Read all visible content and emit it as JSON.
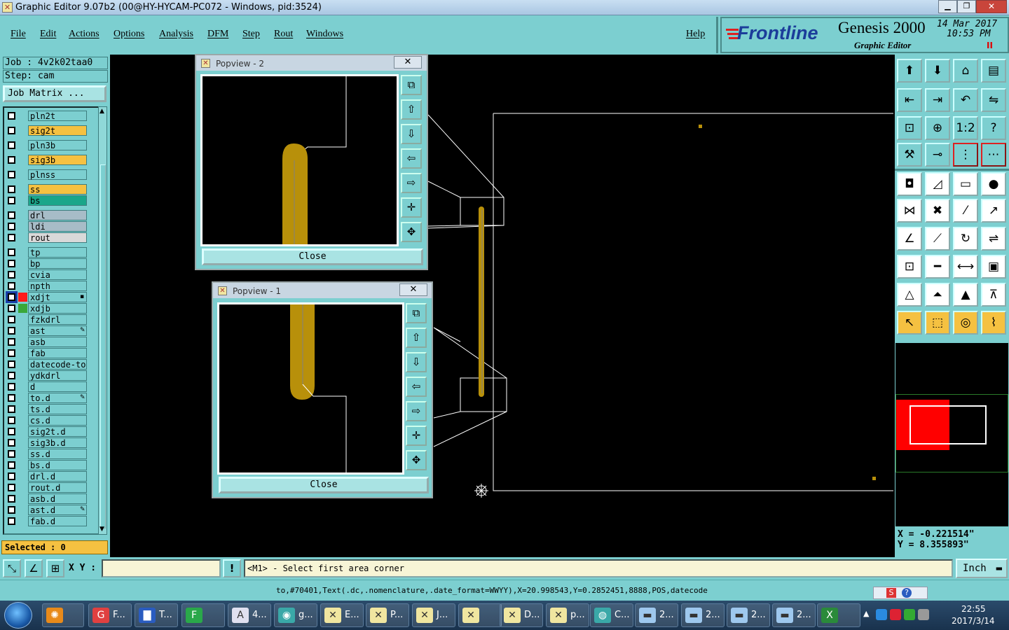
{
  "window": {
    "title": "Graphic Editor 9.07b2 (00@HY-HYCAM-PC072 - Windows, pid:3524)"
  },
  "menu": {
    "items": [
      "File",
      "Edit",
      "Actions",
      "Options",
      "Analysis",
      "DFM",
      "Step",
      "Rout",
      "Windows"
    ],
    "help": "Help"
  },
  "brand": {
    "logo": "Frontline",
    "product": "Genesis 2000",
    "subtitle": "Graphic Editor",
    "date": "14 Mar 2017",
    "time": "10:53 PM",
    "indicator": "II"
  },
  "job": {
    "job_label": "Job : 4v2k02taa0",
    "step_label": "Step: cam",
    "matrix_button": "Job Matrix ..."
  },
  "layers": [
    {
      "name": "pln2t",
      "color": "#7ccfd0"
    },
    {
      "name": "sig2t",
      "color": "#f5c141"
    },
    {
      "name": "pln3b",
      "color": "#7ccfd0"
    },
    {
      "name": "sig3b",
      "color": "#f5c141"
    },
    {
      "name": "plnss",
      "color": "#7ccfd0"
    },
    {
      "name": "ss",
      "color": "#f5c141"
    },
    {
      "name": "bs",
      "color": "#1aa68a"
    },
    {
      "name": "drl",
      "color": "#a7bcc7"
    },
    {
      "name": "ldi",
      "color": "#a7bcc7"
    },
    {
      "name": "rout",
      "color": "#d9d9d9"
    },
    {
      "name": "tp",
      "color": "#7ccfd0"
    },
    {
      "name": "bp",
      "color": "#7ccfd0"
    },
    {
      "name": "cvia",
      "color": "#7ccfd0"
    },
    {
      "name": "npth",
      "color": "#7ccfd0"
    },
    {
      "name": "xdjt",
      "color": "#7ccfd0"
    },
    {
      "name": "xdjb",
      "color": "#7ccfd0"
    },
    {
      "name": "fzkdrl",
      "color": "#7ccfd0"
    },
    {
      "name": "ast",
      "color": "#7ccfd0"
    },
    {
      "name": "asb",
      "color": "#7ccfd0"
    },
    {
      "name": "fab",
      "color": "#7ccfd0"
    },
    {
      "name": "datecode-to",
      "color": "#7ccfd0"
    },
    {
      "name": "ydkdrl",
      "color": "#7ccfd0"
    },
    {
      "name": "d",
      "color": "#7ccfd0"
    },
    {
      "name": "to.d",
      "color": "#7ccfd0"
    },
    {
      "name": "ts.d",
      "color": "#7ccfd0"
    },
    {
      "name": "cs.d",
      "color": "#7ccfd0"
    },
    {
      "name": "sig2t.d",
      "color": "#7ccfd0"
    },
    {
      "name": "sig3b.d",
      "color": "#7ccfd0"
    },
    {
      "name": "ss.d",
      "color": "#7ccfd0"
    },
    {
      "name": "bs.d",
      "color": "#7ccfd0"
    },
    {
      "name": "drl.d",
      "color": "#7ccfd0"
    },
    {
      "name": "rout.d",
      "color": "#7ccfd0"
    },
    {
      "name": "asb.d",
      "color": "#7ccfd0"
    },
    {
      "name": "ast.d",
      "color": "#7ccfd0"
    },
    {
      "name": "fab.d",
      "color": "#7ccfd0"
    }
  ],
  "selected": "Selected : 0",
  "popview2": {
    "title": "Popview - 2",
    "close": "Close",
    "x": "✕"
  },
  "popview1": {
    "title": "Popview - 1",
    "close": "Close",
    "x": "✕"
  },
  "coords": {
    "x": "X = -0.221514\"",
    "y": "Y = 8.355893\""
  },
  "bottom": {
    "xy_label": "X Y :",
    "xy_value": "",
    "warn": "!",
    "prompt": "<M1> - Select first area corner",
    "units": "Inch"
  },
  "status": "to,#70401,Text(.dc,.nomenclature,.date_format=WWYY),X=20.998543,Y=0.2852451,8888,POS,datecode",
  "taskbar": {
    "items": [
      "F...",
      "T...",
      "",
      "4...",
      "g...",
      "E...",
      "P...",
      "J...",
      "",
      "D...",
      "p...",
      "C...",
      "2...",
      "2...",
      "2...",
      "2...",
      ""
    ],
    "clock_time": "22:55",
    "clock_date": "2017/3/14"
  },
  "colors": {
    "accent": "#7ccfd0",
    "copper": "#b8900a",
    "highlight": "#f5c141",
    "red": "#ff0000"
  }
}
